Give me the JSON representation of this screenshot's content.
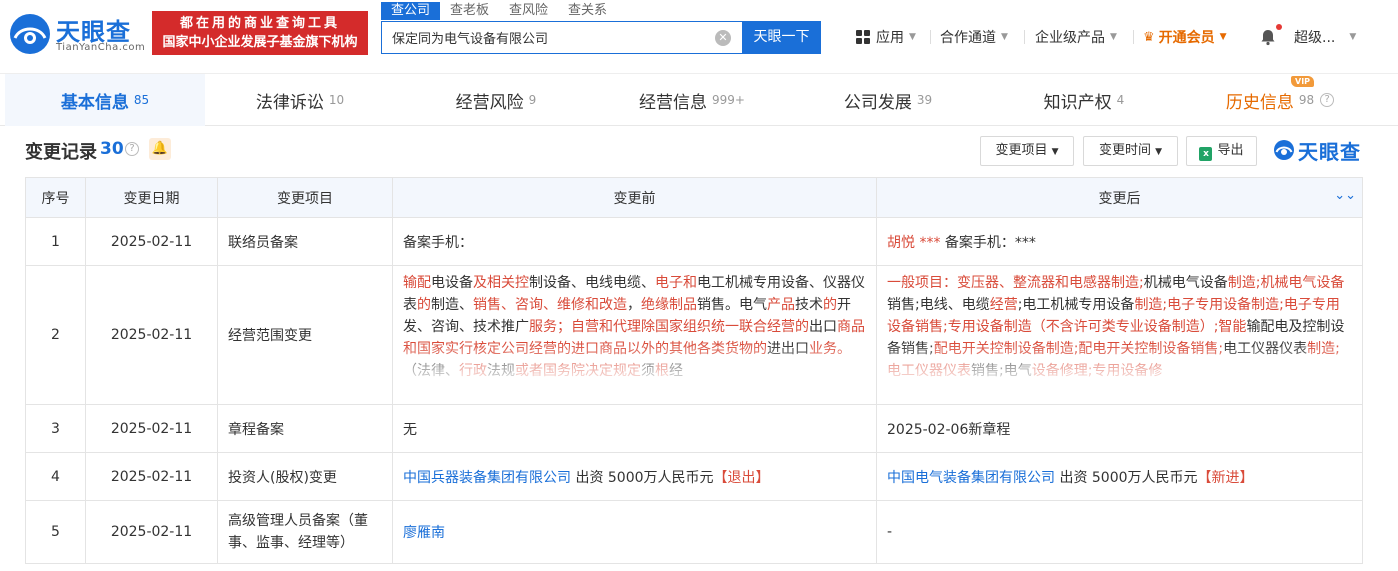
{
  "header": {
    "logo_text": "天眼查",
    "logo_domain": "TianYanCha.com",
    "slogan_line1": "都在用的商业查询工具",
    "slogan_line2": "国家中小企业发展子基金旗下机构",
    "search_tabs": [
      "查公司",
      "查老板",
      "查风险",
      "查关系"
    ],
    "search_value": "保定同为电气设备有限公司",
    "search_button": "天眼一下",
    "nav": {
      "apps": "应用",
      "partner": "合作通道",
      "enterprise": "企业级产品",
      "vip": "开通会员",
      "user": "超级..."
    }
  },
  "tabs": [
    {
      "label": "基本信息",
      "count": "85"
    },
    {
      "label": "法律诉讼",
      "count": "10"
    },
    {
      "label": "经营风险",
      "count": "9"
    },
    {
      "label": "经营信息",
      "count": "999+"
    },
    {
      "label": "公司发展",
      "count": "39"
    },
    {
      "label": "知识产权",
      "count": "4"
    },
    {
      "label": "历史信息",
      "count": "98"
    }
  ],
  "vip_badge": "VIP",
  "section": {
    "title": "变更记录",
    "count": "30",
    "filter_item": "变更项目",
    "filter_time": "变更时间",
    "export": "导出",
    "brand": "天眼查"
  },
  "table": {
    "headers": [
      "序号",
      "变更日期",
      "变更项目",
      "变更前",
      "变更后"
    ],
    "rows": [
      {
        "no": "1",
        "date": "2025-02-11",
        "item": "联络员备案",
        "before_plain": "备案手机：",
        "after_red": "胡悦 ***",
        "after_plain": "备案手机：***"
      },
      {
        "no": "2",
        "date": "2025-02-11",
        "item": "经营范围变更"
      },
      {
        "no": "3",
        "date": "2025-02-11",
        "item": "章程备案",
        "before_red": "无",
        "after_red": "2025-02-06新章程"
      },
      {
        "no": "4",
        "date": "2025-02-11",
        "item": "投资人(股权)变更",
        "before_link": "中国兵器装备集团有限公司",
        "before_mid": "出资 5000万人民币元",
        "before_tag": "【退出】",
        "after_link": "中国电气装备集团有限公司",
        "after_mid": "出资 5000万人民币元",
        "after_tag": "【新进】"
      },
      {
        "no": "5",
        "date": "2025-02-11",
        "item": "高级管理人员备案（董事、监事、经理等）",
        "before_link": "廖雁南",
        "after_plain": "-"
      }
    ],
    "scope_before": [
      {
        "t": "输配",
        "c": "r"
      },
      {
        "t": "电设备",
        "c": ""
      },
      {
        "t": "及相关控",
        "c": "r"
      },
      {
        "t": "制设备、电线电缆、",
        "c": ""
      },
      {
        "t": "电子和",
        "c": "r"
      },
      {
        "t": "电工机械专用设备、仪器仪表",
        "c": ""
      },
      {
        "t": "的",
        "c": "r"
      },
      {
        "t": "制造、",
        "c": ""
      },
      {
        "t": "销售、咨询、维修和改造",
        "c": "r"
      },
      {
        "t": "，",
        "c": ""
      },
      {
        "t": "绝缘制品",
        "c": "r"
      },
      {
        "t": "销售。电气",
        "c": ""
      },
      {
        "t": "产品",
        "c": "r"
      },
      {
        "t": "技术",
        "c": ""
      },
      {
        "t": "的",
        "c": "r"
      },
      {
        "t": "开发、咨询、技术推广",
        "c": ""
      },
      {
        "t": "服务；自营和代理除国家组织统一联合经营的",
        "c": "r"
      },
      {
        "t": "出口",
        "c": ""
      },
      {
        "t": "商品和国家实行核定公司经营的进口商品以外的其他各类货物的",
        "c": "r"
      },
      {
        "t": "进出口",
        "c": ""
      },
      {
        "t": "业务。",
        "c": "r"
      },
      {
        "t": "（法律、",
        "c": ""
      },
      {
        "t": "行政",
        "c": "r"
      },
      {
        "t": "法规",
        "c": ""
      },
      {
        "t": "或者国务院决定规定",
        "c": "r"
      },
      {
        "t": "须",
        "c": ""
      },
      {
        "t": "根",
        "c": "r"
      },
      {
        "t": "经",
        "c": ""
      }
    ],
    "scope_after": [
      {
        "t": "一般项目：变压器、整流器和电感器制造;",
        "c": "r"
      },
      {
        "t": "机械电气设备",
        "c": ""
      },
      {
        "t": "制造;",
        "c": "r"
      },
      {
        "t": "机械电气设备",
        "c": "r"
      },
      {
        "t": "销售;",
        "c": ""
      },
      {
        "t": "电线、电缆",
        "c": ""
      },
      {
        "t": "经营",
        "c": "r"
      },
      {
        "t": ";电工机械专用设备",
        "c": ""
      },
      {
        "t": "制造;电子专用设备制造;电子专用设备销售;专用设备制造（不含许可类专业设备制造）;智能",
        "c": "r"
      },
      {
        "t": "输配电及控制设备销售;",
        "c": ""
      },
      {
        "t": "配电开关控制设备制造;配电开关控制设备销售;",
        "c": "r"
      },
      {
        "t": "电工",
        "c": ""
      },
      {
        "t": "仪器仪表",
        "c": ""
      },
      {
        "t": "制造;",
        "c": "r"
      },
      {
        "t": "电工仪器仪表",
        "c": "r"
      },
      {
        "t": "销售;电气",
        "c": ""
      },
      {
        "t": "设备修理;专用设备修",
        "c": "r"
      }
    ]
  }
}
